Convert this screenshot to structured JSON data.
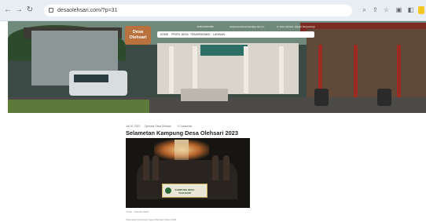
{
  "browser": {
    "url": "desaolehsari.com/?p=31",
    "icons": [
      "back-icon",
      "forward-icon",
      "reload-icon",
      "lock-icon",
      "search-icon",
      "share-icon",
      "star-icon",
      "extensions-icon",
      "sidebar-icon",
      "profile-icon"
    ]
  },
  "site": {
    "logo_line1": "Desa",
    "logo_line2": "Olehsari",
    "topbar": {
      "phone": "+6281234567890",
      "email": "pelayanandesaolehsari@gmail.com",
      "address": "Jl. Desa Olehsari, Glagah, Banyuwangi"
    },
    "menu": [
      "HOME",
      "PROFIL DESA",
      "TRANSPARANSI",
      "LAYANAN"
    ]
  },
  "post": {
    "date": "Juli 30, 2023",
    "author": "Operator Desa Olehsari",
    "comments": "0 Comments",
    "title": "Selametan Kampung Desa Olehsari 2023",
    "banner_text": "KAMPUNG DESA OLEHSARI",
    "caption": "\"Kebo - Keboan 2023\"",
    "body": "Selametan Kampung Desa Olehsari Tahun 2023"
  },
  "colors": {
    "logo_bg": "#b9713d",
    "chrome_bg": "#e9eef5"
  }
}
